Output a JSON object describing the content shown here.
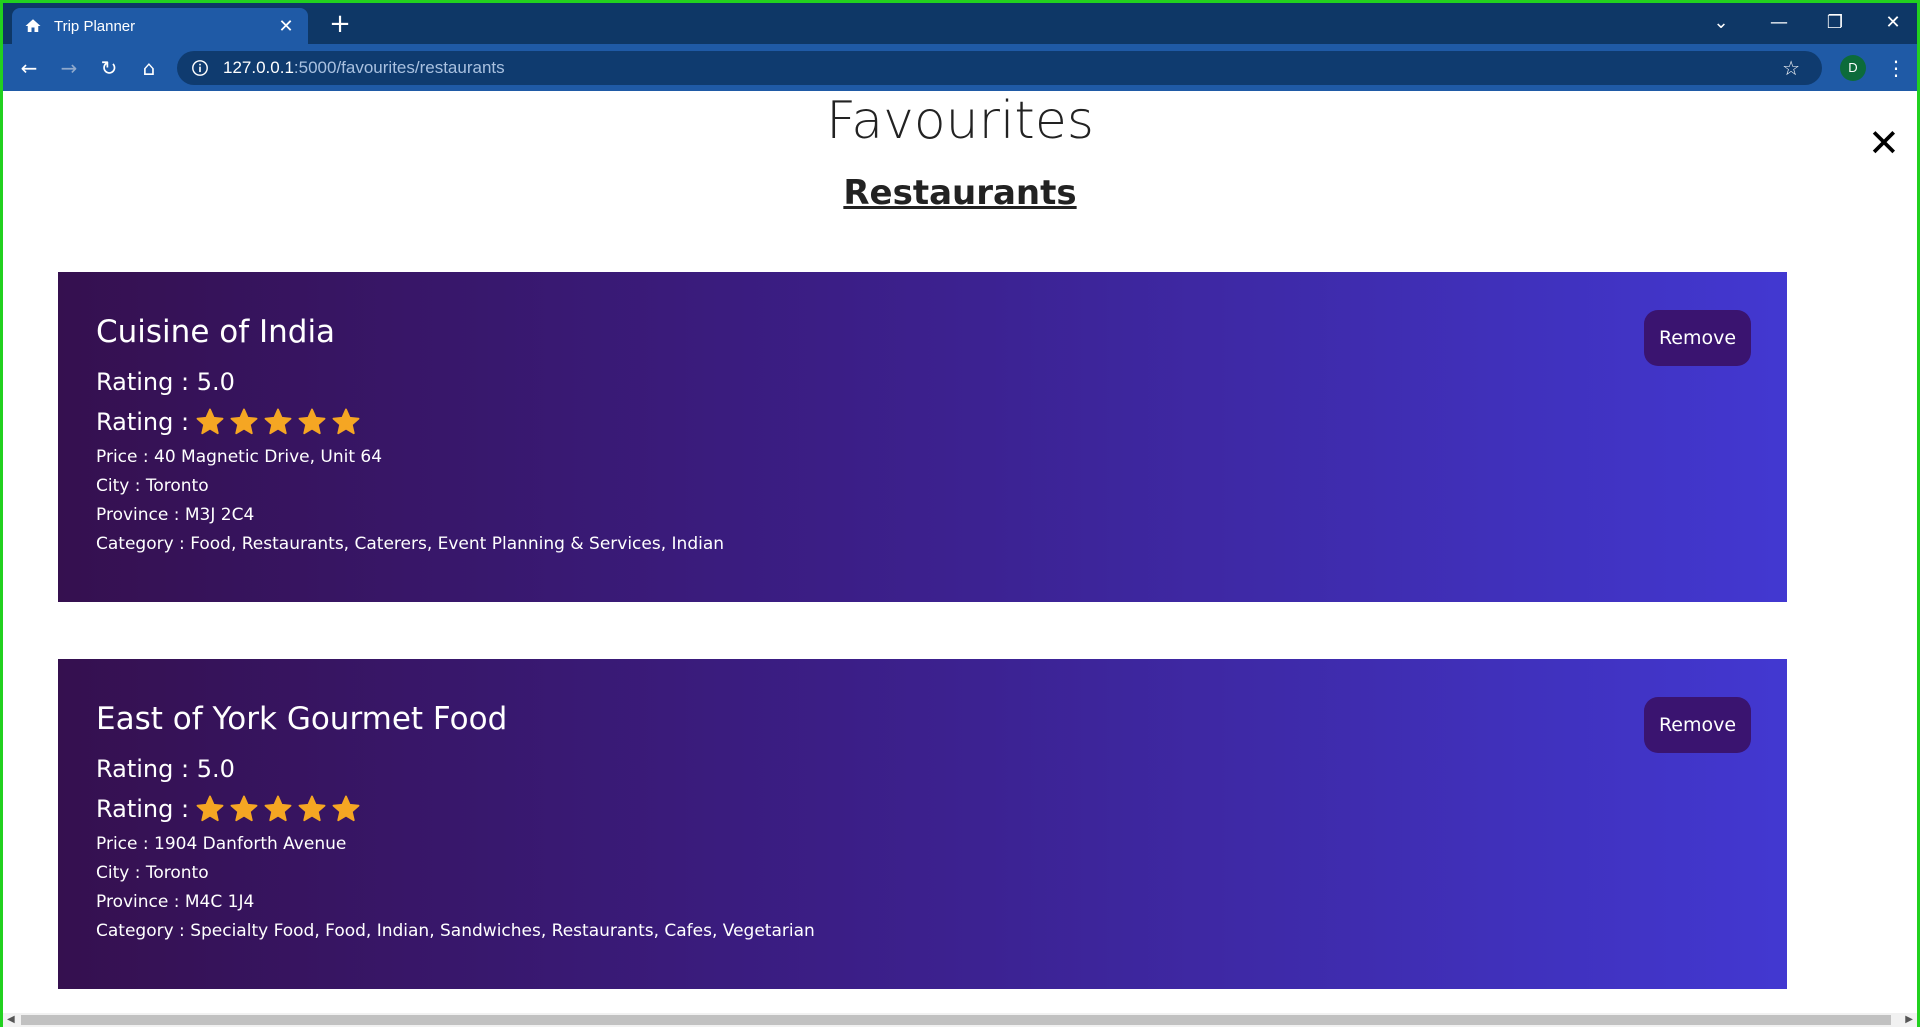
{
  "browser": {
    "tab_title": "Trip Planner",
    "tab_close": "✕",
    "new_tab": "+",
    "url_host": "127.0.0.1",
    "url_path": ":5000/favourites/restaurants",
    "profile_initial": "D"
  },
  "page": {
    "title": "Favourites",
    "close_symbol": "✕",
    "section_title": "Restaurants"
  },
  "labels": {
    "rating": "Rating :",
    "price": "Price :",
    "city": "City :",
    "province": "Province :",
    "category": "Category :",
    "remove": "Remove"
  },
  "restaurants": [
    {
      "name": "Cuisine of India",
      "rating_text": "Rating : 5.0",
      "stars": 5,
      "price": "Price : 40 Magnetic Drive, Unit 64",
      "city": "City : Toronto",
      "province": "Province : M3J 2C4",
      "category": "Category : Food, Restaurants, Caterers, Event Planning & Services, Indian"
    },
    {
      "name": "East of York Gourmet Food",
      "rating_text": "Rating : 5.0",
      "stars": 5,
      "price": "Price : 1904 Danforth Avenue",
      "city": "City : Toronto",
      "province": "Province : M4C 1J4",
      "category": "Category : Specialty Food, Food, Indian, Sandwiches, Restaurants, Cafes, Vegetarian"
    }
  ],
  "colors": {
    "star": "#f5a623",
    "card_start": "#35104f",
    "card_end": "#4238d1",
    "remove_bg": "#3a1470"
  }
}
